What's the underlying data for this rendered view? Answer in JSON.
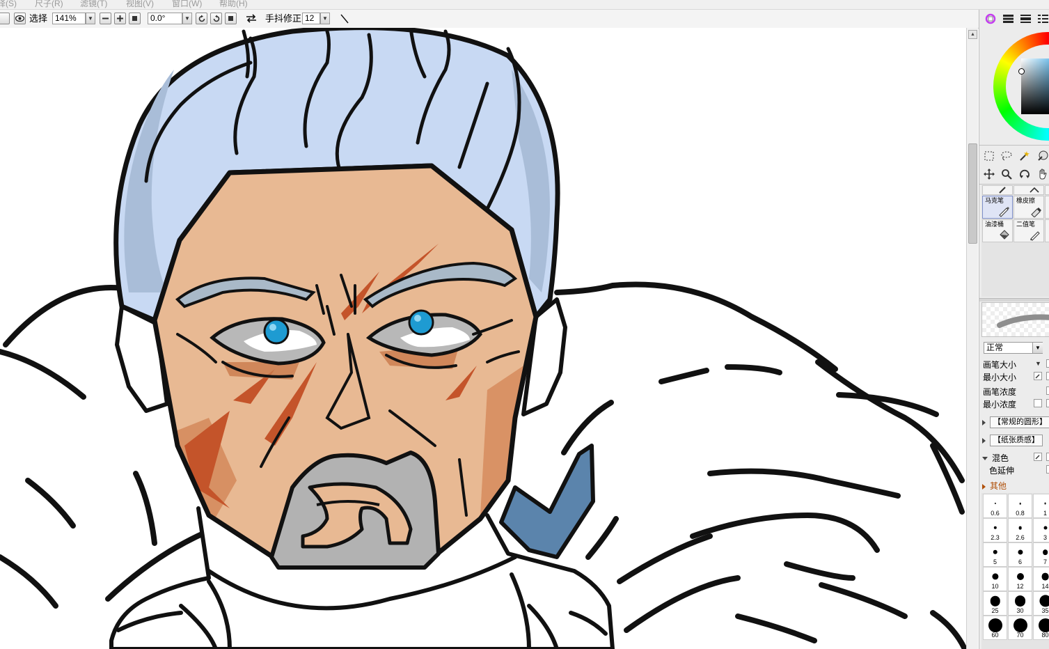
{
  "menu": [
    "择(S)",
    "尺子(R)",
    "滤镜(T)",
    "视图(V)",
    "窗口(W)",
    "帮助(H)"
  ],
  "toolbar": {
    "select_label": "选择",
    "zoom_value": "141%",
    "rotation_value": "0.0°",
    "stabilizer_label": "手抖修正",
    "stabilizer_value": "12"
  },
  "tools": {
    "brushes": [
      {
        "label": "马克笔",
        "selected": true
      },
      {
        "label": "橡皮擦",
        "selected": false
      },
      {
        "label": "油漆桶",
        "selected": false
      },
      {
        "label": "二值笔",
        "selected": false
      }
    ]
  },
  "brush_settings": {
    "blend_mode": "正常",
    "brush_size_label": "画笔大小",
    "min_size_label": "最小大小",
    "density_label": "画笔浓度",
    "min_density_label": "最小浓度",
    "shape_button": "【常规的圆形】",
    "texture_button": "【纸张质感】",
    "mix_label": "混色",
    "color_extend_label": "色延伸",
    "other_label": "其他"
  },
  "brush_sizes": [
    [
      "0.6",
      "0.8",
      "1"
    ],
    [
      "2.3",
      "2.6",
      "3"
    ],
    [
      "5",
      "6",
      "7"
    ],
    [
      "10",
      "12",
      "14"
    ],
    [
      "25",
      "30",
      "35"
    ],
    [
      "60",
      "70",
      "80"
    ]
  ],
  "colors": {
    "hair": "#c8d9f3",
    "hair_shadow": "#a9bdd8",
    "skin": "#e8b993",
    "skin_shadow": "#d4885a",
    "scar": "#c4542a",
    "beard": "#b2b2b2",
    "collar": "#5b84ac",
    "eye": "#1e9bd2",
    "line": "#111111"
  }
}
